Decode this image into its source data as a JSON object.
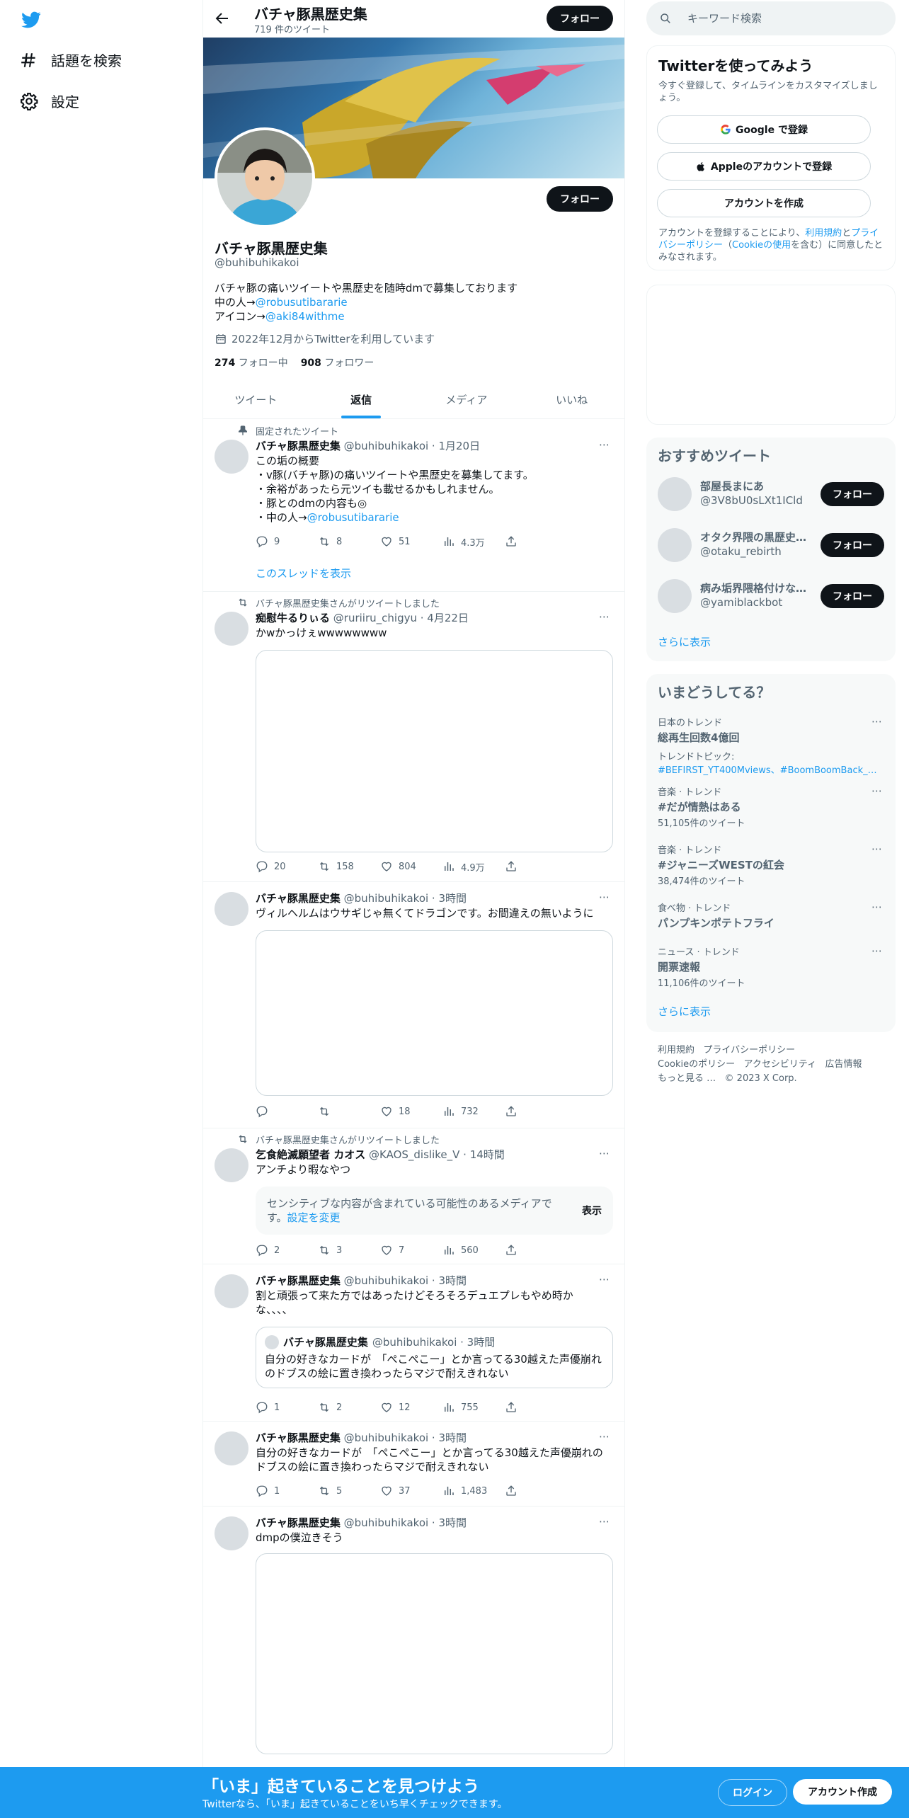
{
  "sidebar": {
    "logo_icon": "twitter-bird-icon",
    "items": [
      {
        "label": "話題を検索",
        "icon": "hash-icon"
      },
      {
        "label": "設定",
        "icon": "gear-icon"
      }
    ]
  },
  "header": {
    "name": "バチャ豚黒歴史集",
    "tweet_count": "719 件のツイート",
    "follow_label": "フォロー"
  },
  "profile": {
    "name": "バチャ豚黒歴史集",
    "handle": "@buhibuhikakoi",
    "bio_line1": "バチャ豚の痛いツイートや黒歴史を随時dmで募集しております",
    "bio_line2_prefix": "中の人→",
    "bio_line2_link": "@robusutibararie",
    "bio_line3_prefix": "アイコン→",
    "bio_line3_link": "@aki84withme",
    "joined": "2022年12月からTwitterを利用しています",
    "following_count": "274",
    "following_label": "フォロー中",
    "followers_count": "908",
    "followers_label": "フォロワー",
    "follow_label": "フォロー"
  },
  "tabs": [
    {
      "label": "ツイート",
      "active": false
    },
    {
      "label": "返信",
      "active": true
    },
    {
      "label": "メディア",
      "active": false
    },
    {
      "label": "いいね",
      "active": false
    }
  ],
  "tweets": [
    {
      "social": "固定されたツイート",
      "name": "バチャ豚黒歴史集",
      "meta": "@buhibuhikakoi · 1月20日",
      "text": "この垢の概要\n・v豚(バチャ豚)の痛いツイートや黒歴史を募集してます。\n・余裕があったら元ツイも載せるかもしれません。\n・豚とのdmの内容も◎\n・中の人→",
      "text_link": "@robusutibararie",
      "replies": "9",
      "retweets": "8",
      "likes": "51",
      "views": "4.3万",
      "thread_link": "このスレッドを表示"
    },
    {
      "social": "バチャ豚黒歴史集さんがリツイートしました",
      "name": "痴慰牛るりぃる",
      "meta": "@ruriiru_chigyu · 4月22日",
      "text": "かwかっけぇwwwwwwww",
      "replies": "20",
      "retweets": "158",
      "likes": "804",
      "views": "4.9万"
    },
    {
      "name": "バチャ豚黒歴史集",
      "meta": "@buhibuhikakoi · 3時間",
      "text": "ヴィルヘルムはウサギじゃ無くてドラゴンです。お間違えの無いように",
      "replies": "",
      "retweets": "",
      "likes": "18",
      "views": "732"
    },
    {
      "social": "バチャ豚黒歴史集さんがリツイートしました",
      "name": "乞食絶滅願望者 カオス",
      "meta": "@KAOS_dislike_V · 14時間",
      "text": "アンチより暇なやつ",
      "sensitive_msg": "センシティブな内容が含まれている可能性のあるメディアです。",
      "sensitive_link": "設定を変更",
      "sensitive_show": "表示",
      "replies": "2",
      "retweets": "3",
      "likes": "7",
      "views": "560"
    },
    {
      "name": "バチャ豚黒歴史集",
      "meta": "@buhibuhikakoi · 3時間",
      "text": "割と頑張って来た方ではあったけどそろそろデュエプレもやめ時かな、、、、",
      "quote_name": "バチャ豚黒歴史集",
      "quote_meta": "@buhibuhikakoi · 3時間",
      "quote_text": "自分の好きなカードが　「ぺこぺこー」とか言ってる30越えた声優崩れのドブスの絵に置き換わったらマジで耐えきれない",
      "replies": "1",
      "retweets": "2",
      "likes": "12",
      "views": "755"
    },
    {
      "name": "バチャ豚黒歴史集",
      "meta": "@buhibuhikakoi · 3時間",
      "text": "自分の好きなカードが　「ぺこぺこー」とか言ってる30越えた声優崩れのドブスの絵に置き換わったらマジで耐えきれない",
      "replies": "1",
      "retweets": "5",
      "likes": "37",
      "views": "1,483"
    },
    {
      "name": "バチャ豚黒歴史集",
      "meta": "@buhibuhikakoi · 3時間",
      "text": "dmpの僕泣きそう"
    }
  ],
  "right": {
    "search_placeholder": "キーワード検索",
    "signup": {
      "title": "Twitterを使ってみよう",
      "subtitle": "今すぐ登録して、タイムラインをカスタマイズしましょう。",
      "google": "Google で登録",
      "apple": "Appleのアカウントで登録",
      "create": "アカウントを作成",
      "terms_prefix": "アカウントを登録することにより、",
      "terms_link": "利用規約",
      "terms_mid": "と",
      "privacy_link": "プライバシーポリシー",
      "terms_paren_open": "（",
      "cookie_link": "Cookieの使用",
      "terms_suffix": "を含む）に同意したとみなされます。"
    },
    "recommend": {
      "title": "おすすめツイート",
      "items": [
        {
          "name": "部屋長まにあ",
          "handle": "@3V8bU0sLXt1ICld",
          "btn": "フォロー"
        },
        {
          "name": "オタク界隈の黒歴史…",
          "handle": "@otaku_rebirth",
          "btn": "フォロー"
        },
        {
          "name": "病み垢界隈格付けな…",
          "handle": "@yamiblackbot",
          "btn": "フォロー"
        }
      ],
      "more": "さらに表示"
    },
    "trends": {
      "title": "いまどうしてる？",
      "items": [
        {
          "ctx": "日本のトレンド",
          "title": "総再生回数4億回",
          "sub_label": "トレンドトピック:",
          "sub_links": "#BEFIRST_YT400Mviews、#BoomBoomBack_MV_..."
        },
        {
          "ctx": "音楽 · トレンド",
          "title": "#だが情熱はある",
          "count": "51,105件のツイート"
        },
        {
          "ctx": "音楽 · トレンド",
          "title": "#ジャニーズWESTの紅会",
          "count": "38,474件のツイート"
        },
        {
          "ctx": "食べ物 · トレンド",
          "title": "パンプキンポテトフライ",
          "count": ""
        },
        {
          "ctx": "ニュース · トレンド",
          "title": "開票速報",
          "count": "11,106件のツイート"
        }
      ],
      "more": "さらに表示"
    },
    "footer": {
      "terms": "利用規約",
      "privacy": "プライバシーポリシー",
      "cookie": "Cookieのポリシー",
      "accessibility": "アクセシビリティ",
      "ads": "広告情報",
      "more": "もっと見る …",
      "copyright": "© 2023 X Corp."
    }
  },
  "bottombar": {
    "title": "「いま」起きていることを見つけよう",
    "subtitle": "Twitterなら、「いま」起きていることをいち早くチェックできます。",
    "login": "ログイン",
    "signup": "アカウント作成"
  },
  "colors": {
    "accent": "#1d9bf0",
    "text": "#0f1419",
    "muted": "#536471"
  }
}
